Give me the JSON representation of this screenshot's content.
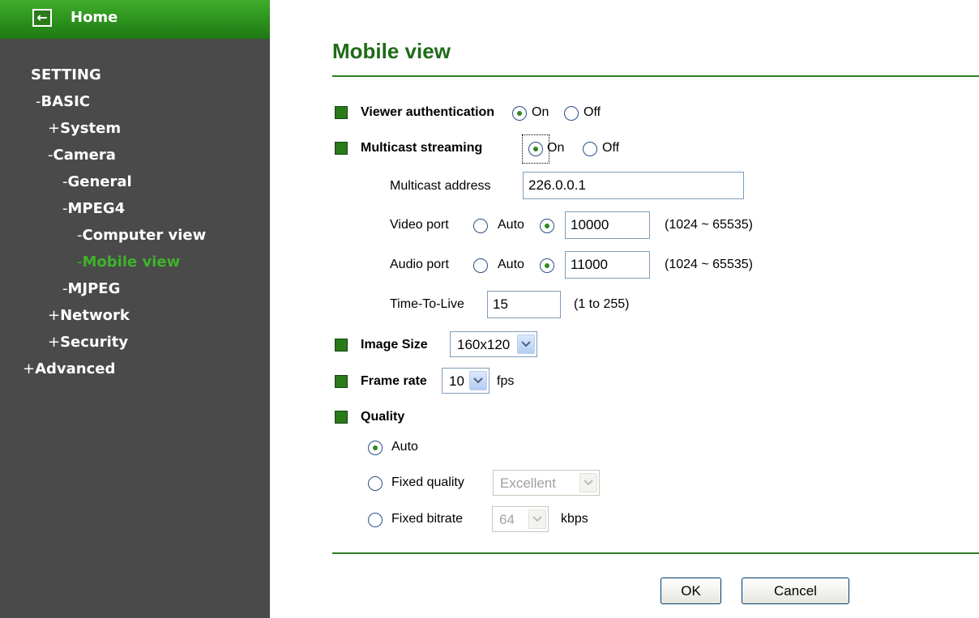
{
  "sidebar": {
    "home_label": "Home",
    "home_icon": "arrow-left-icon",
    "title": "SETTING",
    "items": [
      {
        "marker": "-",
        "label": "BASIC"
      },
      {
        "marker": "+",
        "label": "System"
      },
      {
        "marker": "-",
        "label": "Camera"
      },
      {
        "marker": "-",
        "label": "General"
      },
      {
        "marker": "-",
        "label": "MPEG4"
      },
      {
        "marker": "-",
        "label": "Computer view"
      },
      {
        "marker": "-",
        "label": "Mobile view"
      },
      {
        "marker": "-",
        "label": "MJPEG"
      },
      {
        "marker": "+",
        "label": "Network"
      },
      {
        "marker": "+",
        "label": "Security"
      },
      {
        "marker": "+",
        "label": "Advanced"
      }
    ],
    "active_item": "Mobile view"
  },
  "page": {
    "title": "Mobile view"
  },
  "viewer_auth": {
    "label": "Viewer authentication",
    "on": "On",
    "off": "Off",
    "selected": "On"
  },
  "multicast": {
    "label": "Multicast streaming",
    "on": "On",
    "off": "Off",
    "selected": "On",
    "address_label": "Multicast address",
    "address": "226.0.0.1",
    "video_port_label": "Video port",
    "video_auto": "Auto",
    "video_port": "10000",
    "video_selected": "manual",
    "video_range": "(1024 ~ 65535)",
    "audio_port_label": "Audio port",
    "audio_auto": "Auto",
    "audio_port": "11000",
    "audio_selected": "manual",
    "audio_range": "(1024 ~ 65535)",
    "ttl_label": "Time-To-Live",
    "ttl": "15",
    "ttl_range": "(1 to 255)"
  },
  "image_size": {
    "label": "Image Size",
    "value": "160x120"
  },
  "frame_rate": {
    "label": "Frame rate",
    "value": "10",
    "unit": "fps"
  },
  "quality": {
    "label": "Quality",
    "auto": "Auto",
    "fixed_quality": "Fixed quality",
    "fixed_quality_value": "Excellent",
    "fixed_bitrate": "Fixed bitrate",
    "fixed_bitrate_value": "64",
    "bitrate_unit": "kbps",
    "selected": "Auto"
  },
  "buttons": {
    "ok": "OK",
    "cancel": "Cancel"
  },
  "colors": {
    "accent_green": "#2a7a1a",
    "title_green": "#1f6b18",
    "active_nav": "#3db32a",
    "sidebar_bg": "#4a4a4a"
  }
}
